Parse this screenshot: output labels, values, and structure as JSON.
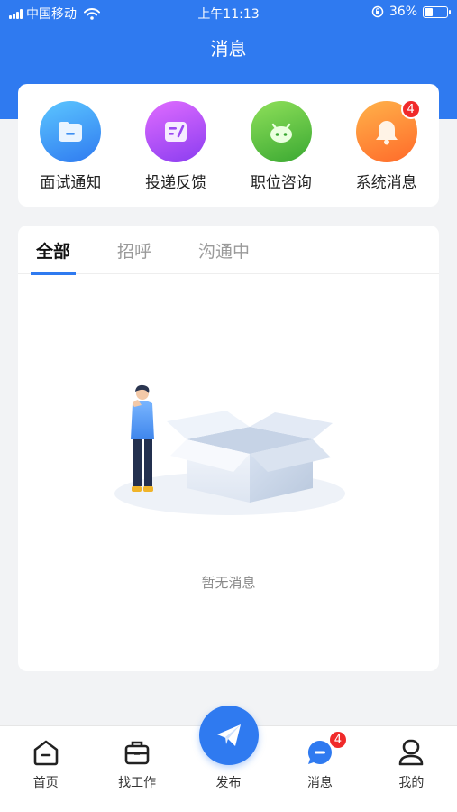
{
  "status_bar": {
    "carrier": "中国移动",
    "time": "上午11:13",
    "battery": "36%",
    "battery_level": 0.36
  },
  "header": {
    "title": "消息"
  },
  "quick_actions": [
    {
      "label": "面试通知",
      "icon": "folder-icon",
      "color": "#3fa3f5"
    },
    {
      "label": "投递反馈",
      "icon": "feedback-icon",
      "color": "#b04ff0"
    },
    {
      "label": "职位咨询",
      "icon": "chat-bot-icon",
      "color": "#5cc23e"
    },
    {
      "label": "系统消息",
      "icon": "bell-icon",
      "color": "#ff7a3a",
      "badge": "4"
    }
  ],
  "tabs": [
    {
      "label": "全部",
      "active": true
    },
    {
      "label": "招呼",
      "active": false
    },
    {
      "label": "沟通中",
      "active": false
    }
  ],
  "empty_state": {
    "text": "暂无消息"
  },
  "tabbar": {
    "items": [
      {
        "label": "首页",
        "icon": "home-icon"
      },
      {
        "label": "找工作",
        "icon": "briefcase-icon"
      },
      {
        "label": "发布",
        "icon": "paper-plane-icon"
      },
      {
        "label": "消息",
        "icon": "message-icon",
        "badge": "4"
      },
      {
        "label": "我的",
        "icon": "profile-icon"
      }
    ]
  },
  "colors": {
    "accent": "#2f7af0",
    "badge": "#f02a2a",
    "background": "#f2f3f5"
  }
}
